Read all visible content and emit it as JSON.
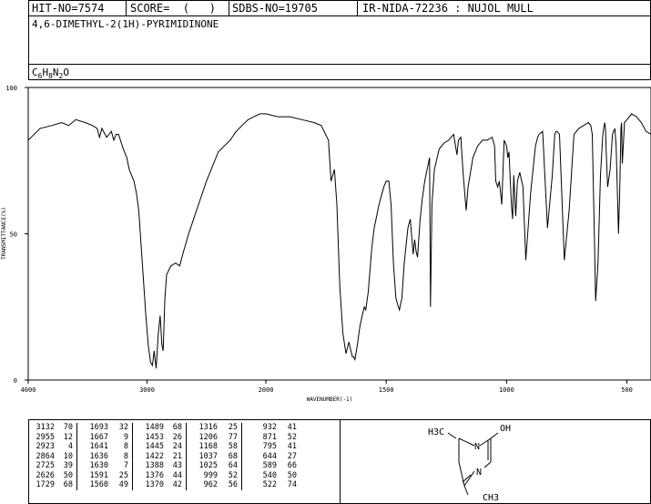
{
  "header": {
    "hit_no": "HIT-NO=7574",
    "score": "SCORE=  (   )",
    "sdbs_no": "SDBS-NO=19705",
    "ir_nida": "IR-NIDA-72236 : NUJOL MULL"
  },
  "compound": {
    "name": "4,6-DIMETHYL-2(1H)-PYRIMIDINONE",
    "formula_parts": [
      "C",
      "6",
      "H",
      "8",
      "N",
      "2",
      "O"
    ]
  },
  "chart_data": {
    "type": "line",
    "title": "",
    "xlabel": "WAVENUMBER(-1)",
    "ylabel": "TRANSMITTANCE(%)",
    "xlim": [
      4000,
      400
    ],
    "ylim": [
      0,
      100
    ],
    "x_ticks": [
      4000,
      3000,
      2000,
      1500,
      1000,
      500
    ],
    "y_ticks": [
      0,
      50,
      100
    ],
    "grid": false,
    "series": [
      {
        "x": [
          4000,
          3900,
          3800,
          3720,
          3660,
          3600,
          3520,
          3460,
          3420,
          3400,
          3380,
          3340,
          3300,
          3280,
          3260,
          3240,
          3200,
          3170,
          3150,
          3130,
          3110,
          3090,
          3070,
          3050,
          3030,
          3010,
          2990,
          2970,
          2955,
          2940,
          2923,
          2905,
          2890,
          2875,
          2864,
          2850,
          2835,
          2800,
          2760,
          2725,
          2700,
          2650,
          2600,
          2550,
          2500,
          2450,
          2400,
          2350,
          2300,
          2250,
          2200,
          2150,
          2100,
          2050,
          2000,
          1950,
          1900,
          1850,
          1800,
          1770,
          1740,
          1729,
          1715,
          1705,
          1693,
          1680,
          1667,
          1655,
          1641,
          1636,
          1630,
          1620,
          1610,
          1600,
          1591,
          1585,
          1575,
          1560,
          1550,
          1530,
          1510,
          1500,
          1489,
          1480,
          1470,
          1460,
          1453,
          1445,
          1435,
          1425,
          1410,
          1400,
          1388,
          1382,
          1376,
          1370,
          1360,
          1350,
          1340,
          1330,
          1320,
          1316,
          1310,
          1300,
          1280,
          1260,
          1240,
          1220,
          1212,
          1206,
          1200,
          1190,
          1180,
          1168,
          1160,
          1140,
          1120,
          1100,
          1080,
          1060,
          1050,
          1045,
          1037,
          1030,
          1025,
          1020,
          1010,
          1000,
          995,
          990,
          980,
          975,
          970,
          962,
          955,
          945,
          932,
          920,
          900,
          880,
          871,
          865,
          850,
          830,
          810,
          800,
          795,
          790,
          780,
          760,
          740,
          720,
          700,
          680,
          660,
          650,
          644,
          638,
          630,
          620,
          610,
          600,
          592,
          589,
          586,
          580,
          570,
          560,
          550,
          545,
          540,
          535,
          530,
          525,
          522,
          519,
          510,
          500,
          480,
          460,
          440,
          420,
          400
        ],
        "values": [
          82,
          86,
          87,
          88,
          87,
          89,
          88,
          87,
          86,
          83,
          86,
          83,
          85,
          82,
          84,
          84,
          79,
          76,
          72,
          70,
          68,
          64,
          58,
          46,
          34,
          22,
          12,
          6,
          5,
          10,
          4,
          16,
          22,
          12,
          10,
          28,
          36,
          39,
          40,
          39,
          43,
          50,
          56,
          62,
          68,
          73,
          78,
          80,
          82,
          85,
          87,
          89,
          90,
          91,
          91,
          90,
          90,
          89,
          88,
          87,
          82,
          68,
          72,
          60,
          32,
          16,
          9,
          13,
          8,
          8,
          7,
          12,
          18,
          22,
          25,
          24,
          30,
          45,
          52,
          60,
          66,
          68,
          68,
          60,
          40,
          28,
          26,
          24,
          28,
          40,
          52,
          55,
          43,
          48,
          44,
          42,
          54,
          62,
          68,
          72,
          76,
          25,
          60,
          72,
          79,
          81,
          82,
          84,
          80,
          77,
          82,
          83,
          70,
          58,
          66,
          76,
          80,
          82,
          82,
          83,
          80,
          68,
          66,
          68,
          64,
          60,
          82,
          80,
          76,
          78,
          60,
          55,
          70,
          56,
          68,
          71,
          66,
          41,
          64,
          80,
          83,
          84,
          85,
          52,
          70,
          84,
          85,
          85,
          84,
          41,
          58,
          84,
          86,
          87,
          88,
          87,
          84,
          60,
          27,
          40,
          70,
          84,
          88,
          86,
          78,
          66,
          72,
          84,
          86,
          80,
          65,
          50,
          64,
          86,
          88,
          74,
          88,
          89,
          91,
          90,
          88,
          85,
          84
        ]
      }
    ]
  },
  "peak_table": {
    "columns": [
      [
        [
          "3132",
          "70"
        ],
        [
          "2955",
          "12"
        ],
        [
          "2923",
          "4"
        ],
        [
          "2864",
          "10"
        ],
        [
          "2725",
          "39"
        ],
        [
          "2626",
          "50"
        ],
        [
          "1729",
          "68"
        ]
      ],
      [
        [
          "1693",
          "32"
        ],
        [
          "1667",
          "9"
        ],
        [
          "1641",
          "8"
        ],
        [
          "1636",
          "8"
        ],
        [
          "1630",
          "7"
        ],
        [
          "1591",
          "25"
        ],
        [
          "1560",
          "49"
        ]
      ],
      [
        [
          "1489",
          "68"
        ],
        [
          "1453",
          "26"
        ],
        [
          "1445",
          "24"
        ],
        [
          "1422",
          "21"
        ],
        [
          "1388",
          "43"
        ],
        [
          "1376",
          "44"
        ],
        [
          "1370",
          "42"
        ]
      ],
      [
        [
          "1316",
          "25"
        ],
        [
          "1206",
          "77"
        ],
        [
          "1168",
          "58"
        ],
        [
          "1037",
          "68"
        ],
        [
          "1025",
          "64"
        ],
        [
          "999",
          "52"
        ],
        [
          "962",
          "56"
        ]
      ],
      [
        [
          "932",
          "41"
        ],
        [
          "871",
          "52"
        ],
        [
          "795",
          "41"
        ],
        [
          "644",
          "27"
        ],
        [
          "589",
          "66"
        ],
        [
          "540",
          "50"
        ],
        [
          "522",
          "74"
        ]
      ]
    ]
  },
  "structure": {
    "labels": {
      "methyl_top": "H3C",
      "hydroxyl": "OH",
      "n_top": "N",
      "n_bottom": "N",
      "methyl_bottom": "CH3"
    }
  }
}
